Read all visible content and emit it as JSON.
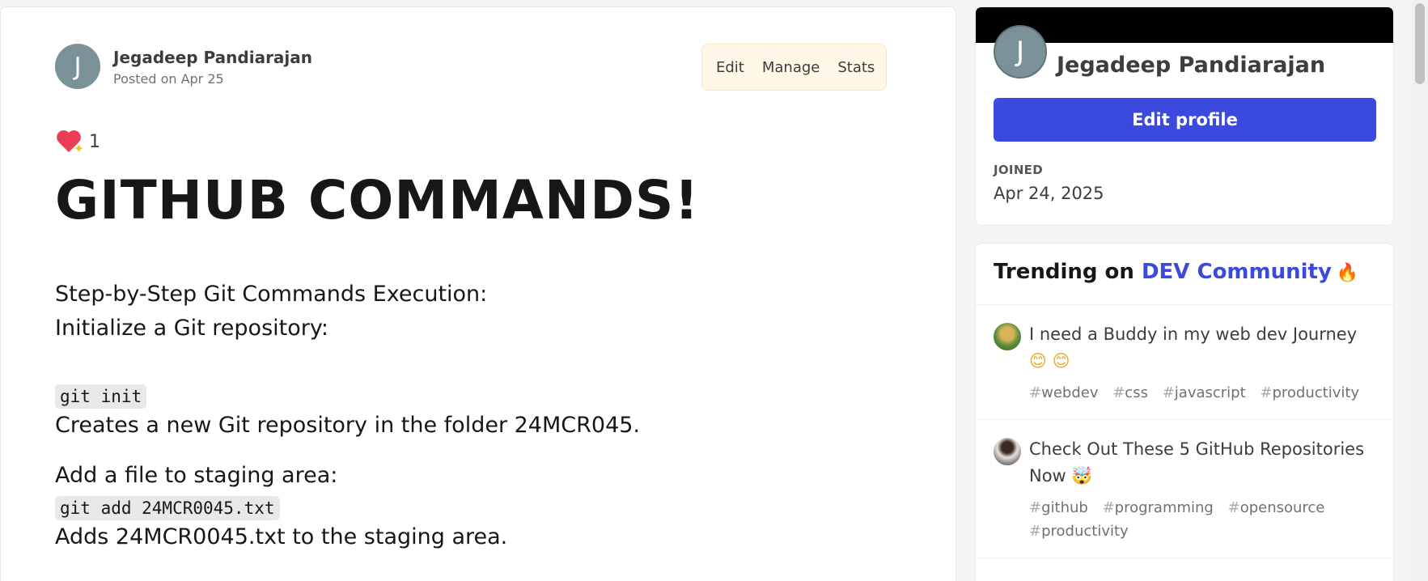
{
  "article": {
    "author": {
      "avatar_letter": "J",
      "name": "Jegadeep Pandiarajan",
      "posted": "Posted on Apr 25"
    },
    "actions": {
      "edit": "Edit",
      "manage": "Manage",
      "stats": "Stats"
    },
    "reactions": {
      "icon": "sparkling-heart-icon",
      "count": "1"
    },
    "title": "GITHUB COMMANDS!",
    "body": {
      "intro_line1": "Step-by-Step Git Commands Execution:",
      "intro_line2": "Initialize a Git repository:",
      "code1": "git init",
      "desc1": "Creates a new Git repository in the folder 24MCR045.",
      "step2": "Add a file to staging area:",
      "code2": "git add 24MCR0045.txt",
      "desc2": "Adds 24MCR0045.txt to the staging area."
    }
  },
  "sidebar": {
    "profile": {
      "avatar_letter": "J",
      "name": "Jegadeep Pandiarajan",
      "edit_button": "Edit profile",
      "joined_label": "JOINED",
      "joined_date": "Apr 24, 2025"
    },
    "trending": {
      "heading_prefix": "Trending on ",
      "heading_brand": "DEV Community",
      "items": [
        {
          "title": "I need a Buddy in my web dev Journey",
          "emoji": "😊 😊",
          "tags": [
            "webdev",
            "css",
            "javascript",
            "productivity"
          ]
        },
        {
          "title": "Check Out These 5 GitHub Repositories Now",
          "emoji": "🤯",
          "tags": [
            "github",
            "programming",
            "opensource",
            "productivity"
          ]
        }
      ]
    }
  },
  "colors": {
    "brand_blue": "#3b49df",
    "avatar_gray": "#7a9197",
    "actions_bg": "#fef6e7",
    "heart_red": "#ea3e57"
  }
}
